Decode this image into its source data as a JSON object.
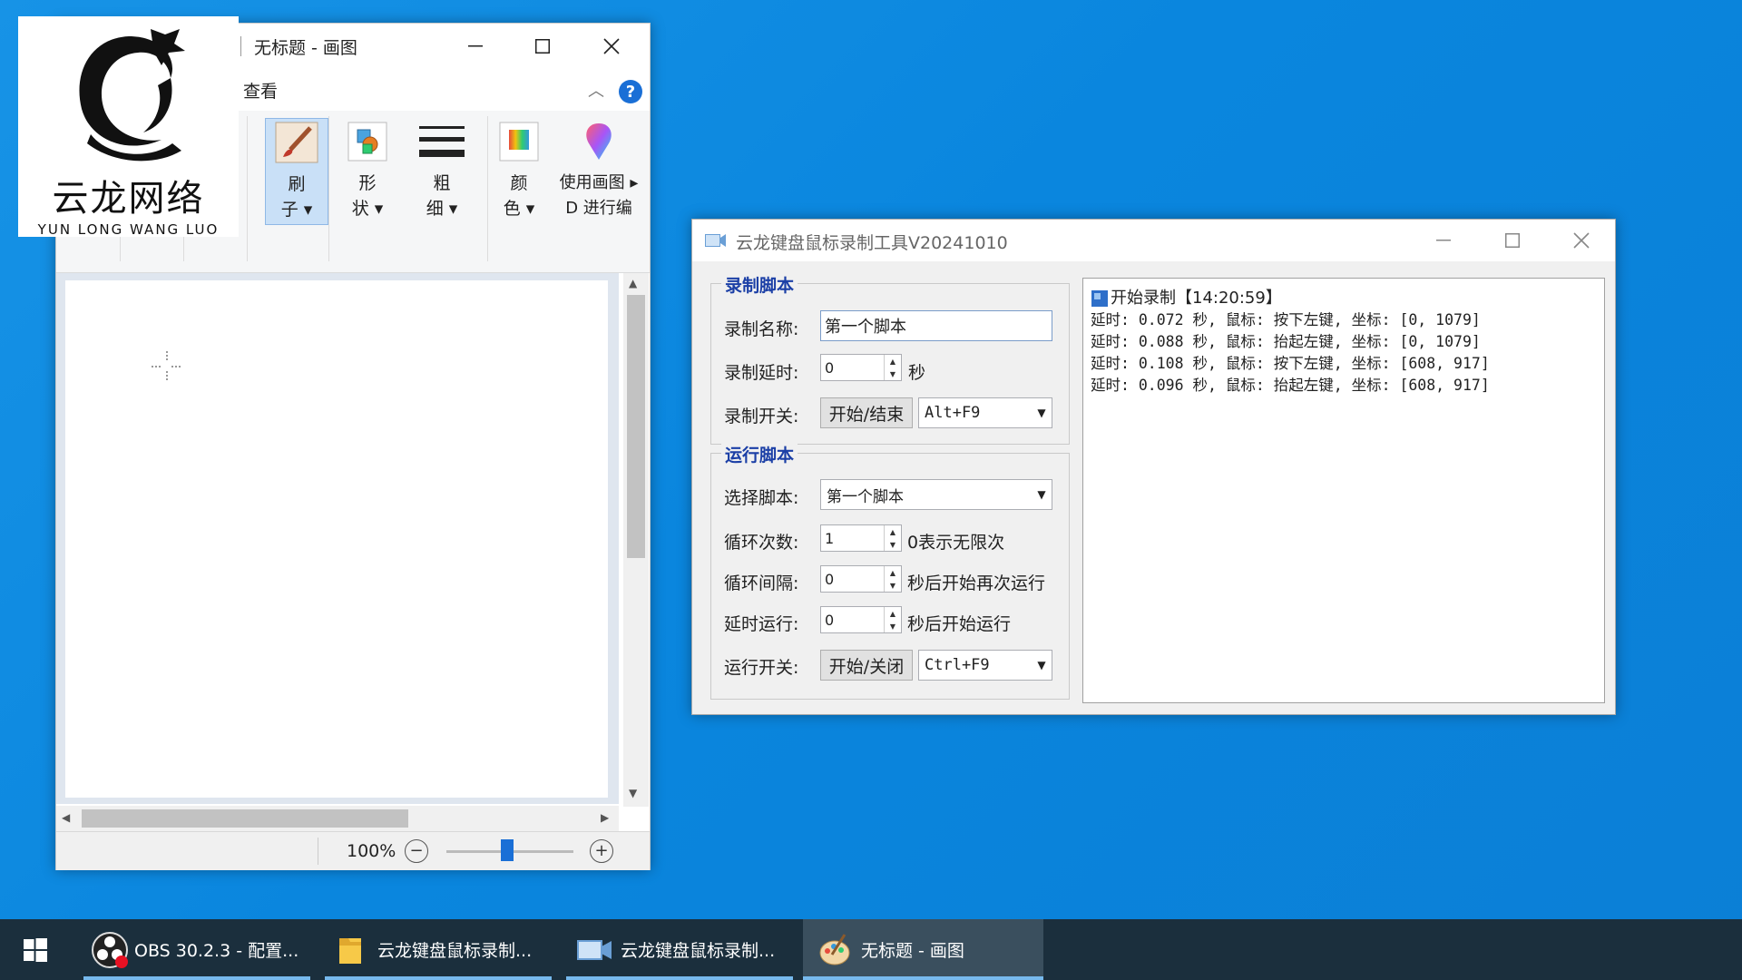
{
  "paint": {
    "title": "无标题 - 画图",
    "menu_view": "查看",
    "tools": [
      {
        "label_line1": "刷",
        "label_line2": "子 ▾"
      },
      {
        "label_line1": "形",
        "label_line2": "状 ▾"
      },
      {
        "label_line1": "粗",
        "label_line2": "细 ▾"
      },
      {
        "label_line1": "颜",
        "label_line2": "色 ▾"
      },
      {
        "label_line1": "使用画图 ▸",
        "label_line2": "D 进行编"
      }
    ],
    "zoom": "100%"
  },
  "logo": {
    "text_cn": "云龙网络",
    "text_en": "YUN LONG WANG LUO"
  },
  "recorder": {
    "title": "云龙键盘鼠标录制工具V20241010",
    "record_group": {
      "title": "录制脚本",
      "name_label": "录制名称:",
      "name_value": "第一个脚本",
      "delay_label": "录制延时:",
      "delay_value": "0",
      "delay_unit": "秒",
      "switch_label": "录制开关:",
      "switch_button": "开始/结束",
      "hotkey": "Alt+F9"
    },
    "run_group": {
      "title": "运行脚本",
      "select_label": "选择脚本:",
      "select_value": "第一个脚本",
      "loop_label": "循环次数:",
      "loop_value": "1",
      "loop_hint": "0表示无限次",
      "interval_label": "循环间隔:",
      "interval_value": "0",
      "interval_hint": "秒后开始再次运行",
      "delay_label": "延时运行:",
      "delay_value": "0",
      "delay_hint": "秒后开始运行",
      "switch_label": "运行开关:",
      "switch_button": "开始/关闭",
      "hotkey": "Ctrl+F9"
    },
    "log": [
      "开始录制【14:20:59】",
      "延时: 0.072 秒, 鼠标: 按下左键, 坐标: [0, 1079]",
      "延时: 0.088 秒, 鼠标: 抬起左键, 坐标: [0, 1079]",
      "延时: 0.108 秒, 鼠标: 按下左键, 坐标: [608, 917]",
      "延时: 0.096 秒, 鼠标: 抬起左键, 坐标: [608, 917]"
    ]
  },
  "taskbar": {
    "items": [
      {
        "label": "OBS 30.2.3 - 配置...",
        "icon": "obs-icon"
      },
      {
        "label": "云龙键盘鼠标录制...",
        "icon": "folder-icon"
      },
      {
        "label": "云龙键盘鼠标录制...",
        "icon": "recorder-app-icon"
      },
      {
        "label": "无标题 - 画图",
        "icon": "paint-icon"
      }
    ]
  },
  "colors": {
    "desktop": "#0b86de",
    "taskbar": "#1b2f3d",
    "group_title": "#1b3fa6",
    "accent": "#1a6fd6"
  }
}
